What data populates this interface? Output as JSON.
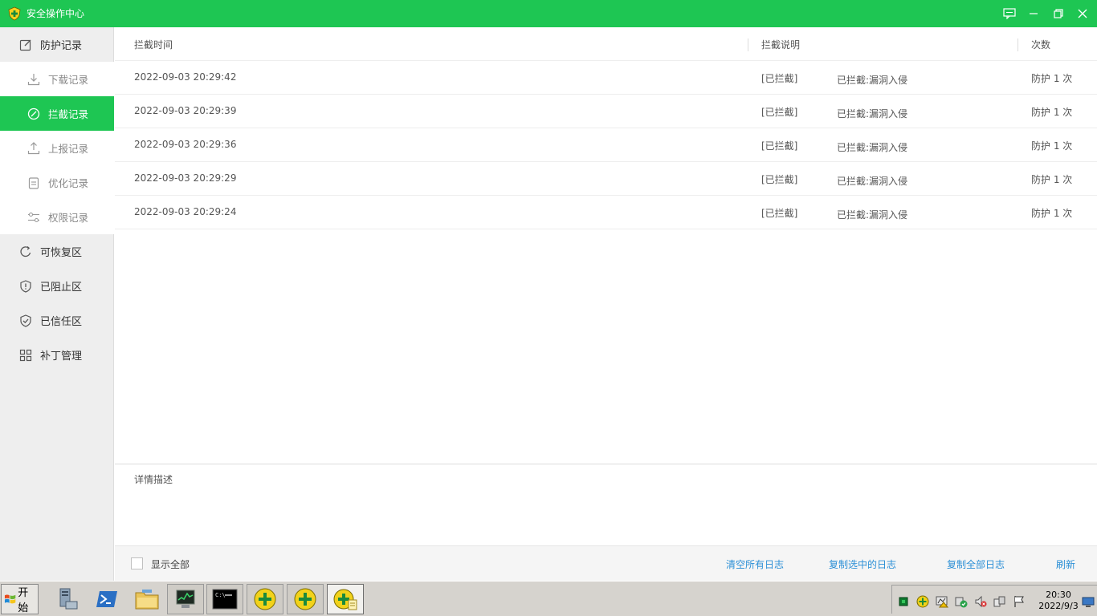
{
  "window": {
    "title": "安全操作中心",
    "accent_color": "#1ec653"
  },
  "sidebar": {
    "items": [
      {
        "label": "防护记录",
        "icon": "edit-icon"
      },
      {
        "label": "下载记录",
        "icon": "download-icon"
      },
      {
        "label": "拦截记录",
        "icon": "block-icon"
      },
      {
        "label": "上报记录",
        "icon": "upload-icon"
      },
      {
        "label": "优化记录",
        "icon": "clipboard-icon"
      },
      {
        "label": "权限记录",
        "icon": "sliders-icon"
      },
      {
        "label": "可恢复区",
        "icon": "refresh-icon"
      },
      {
        "label": "已阻止区",
        "icon": "shield-alert-icon"
      },
      {
        "label": "已信任区",
        "icon": "shield-check-icon"
      },
      {
        "label": "补丁管理",
        "icon": "grid-icon"
      }
    ],
    "active": "拦截记录"
  },
  "table": {
    "columns": [
      "拦截时间",
      "拦截说明",
      "次数"
    ],
    "rows": [
      {
        "time": "2022-09-03 20:29:42",
        "tag": "[已拦截]",
        "desc": "已拦截:漏洞入侵",
        "count": "防护 1 次"
      },
      {
        "time": "2022-09-03 20:29:39",
        "tag": "[已拦截]",
        "desc": "已拦截:漏洞入侵",
        "count": "防护 1 次"
      },
      {
        "time": "2022-09-03 20:29:36",
        "tag": "[已拦截]",
        "desc": "已拦截:漏洞入侵",
        "count": "防护 1 次"
      },
      {
        "time": "2022-09-03 20:29:29",
        "tag": "[已拦截]",
        "desc": "已拦截:漏洞入侵",
        "count": "防护 1 次"
      },
      {
        "time": "2022-09-03 20:29:24",
        "tag": "[已拦截]",
        "desc": "已拦截:漏洞入侵",
        "count": "防护 1 次"
      }
    ]
  },
  "detail": {
    "label": "详情描述"
  },
  "footer": {
    "show_all_label": "显示全部",
    "show_all_checked": false,
    "clear_all": "清空所有日志",
    "copy_selected": "复制选中的日志",
    "copy_all": "复制全部日志",
    "refresh": "刷新",
    "link_color": "#2b8fd6"
  },
  "taskbar": {
    "start_label": "开始",
    "clock_time": "20:30",
    "clock_date": "2022/9/3"
  }
}
